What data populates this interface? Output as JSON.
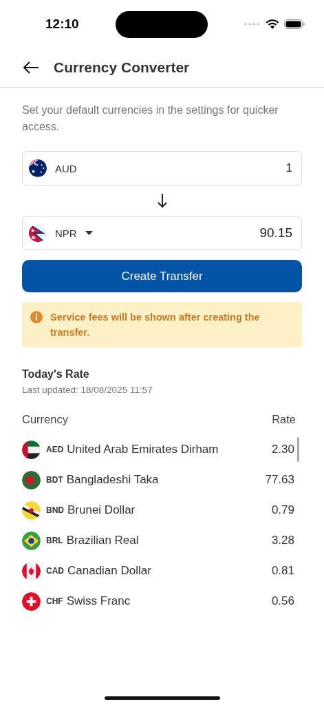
{
  "status_bar": {
    "time": "12:10"
  },
  "header": {
    "title": "Currency Converter"
  },
  "hint": "Set your default currencies in the settings for quicker access.",
  "fields": [
    {
      "kind": "australia",
      "code": "AUD",
      "dropdown": false,
      "value": "1"
    },
    {
      "kind": "nepal",
      "code": "NPR",
      "dropdown": true,
      "value": "90.15"
    }
  ],
  "button": "Create Transfer",
  "notice": "Service fees will be shown after creating the transfer.",
  "rates": {
    "title": "Today's Rate",
    "updated": "Last updated: 18/08/2025 11:57",
    "columns": [
      "Currency",
      "Rate"
    ],
    "rows": [
      {
        "kind": "uae",
        "code": "AED",
        "name": "United Arab Emirates Dirham",
        "rate": "2.30"
      },
      {
        "kind": "bangladesh",
        "code": "BDT",
        "name": "Bangladeshi Taka",
        "rate": "77.63"
      },
      {
        "kind": "brunei",
        "code": "BND",
        "name": "Brunei Dollar",
        "rate": "0.79"
      },
      {
        "kind": "brazil",
        "code": "BRL",
        "name": "Brazilian Real",
        "rate": "3.28"
      },
      {
        "kind": "canada",
        "code": "CAD",
        "name": "Canadian Dollar",
        "rate": "0.81"
      },
      {
        "kind": "switzerland",
        "code": "CHF",
        "name": "Swiss Franc",
        "rate": "0.56"
      }
    ]
  }
}
